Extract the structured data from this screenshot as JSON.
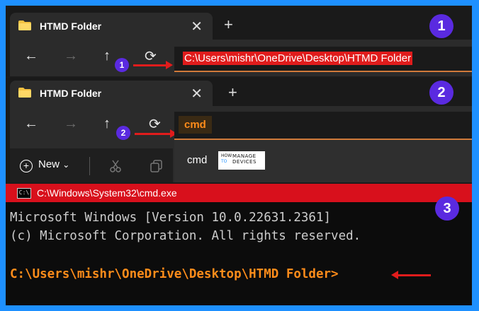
{
  "panel1": {
    "tab_title": "HTMD Folder",
    "tab_close": "✕",
    "new_tab": "+",
    "address_value": "C:\\Users\\mishr\\OneDrive\\Desktop\\HTMD Folder",
    "step": "1",
    "mini_step": "1"
  },
  "panel2": {
    "tab_title": "HTMD Folder",
    "tab_close": "✕",
    "new_tab": "+",
    "address_value": "cmd",
    "suggestion": "cmd",
    "step": "2",
    "mini_step": "2",
    "new_button": "New",
    "logo": {
      "how": "HOW",
      "to": "TO",
      "manage": "MANAGE",
      "devices": "DEVICES"
    }
  },
  "panel3": {
    "window_title": "C:\\Windows\\System32\\cmd.exe",
    "icon_text": "C:\\",
    "step": "3",
    "lines": [
      "Microsoft Windows [Version 10.0.22631.2361]",
      "(c) Microsoft Corporation. All rights reserved."
    ],
    "prompt": "C:\\Users\\mishr\\OneDrive\\Desktop\\HTMD Folder>"
  },
  "icons": {
    "back": "←",
    "forward": "→",
    "up": "↑",
    "refresh": "⟳",
    "chevron": "⌄"
  },
  "colors": {
    "border": "#1e90ff",
    "highlight": "#e01c1c",
    "step_badge": "#5a2ae0",
    "prompt": "#ff8c1a"
  }
}
